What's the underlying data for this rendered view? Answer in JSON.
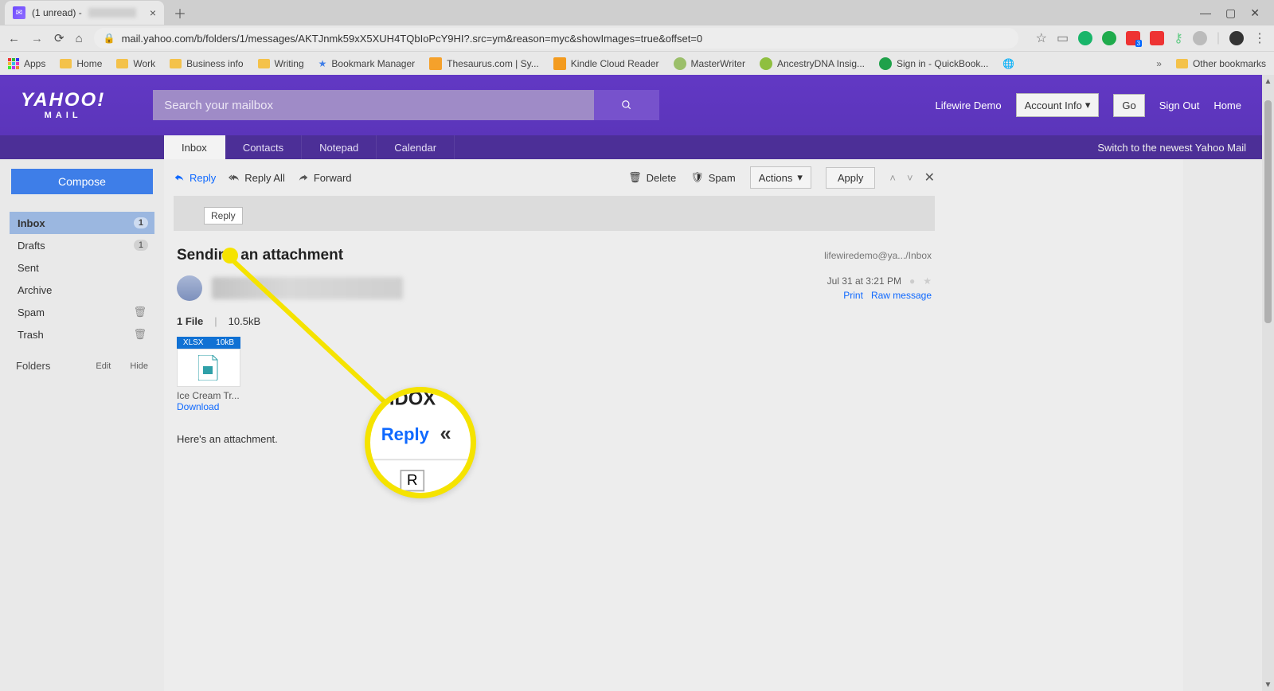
{
  "browser": {
    "tab_title": "(1 unread) -",
    "url": "mail.yahoo.com/b/folders/1/messages/AKTJnmk59xX5XUH4TQbIoPcY9HI?.src=ym&reason=myc&showImages=true&offset=0",
    "bookmarks": [
      "Apps",
      "Home",
      "Work",
      "Business info",
      "Writing",
      "Bookmark Manager",
      "Thesaurus.com | Sy...",
      "Kindle Cloud Reader",
      "MasterWriter",
      "AncestryDNA Insig...",
      "Sign in - QuickBook..."
    ],
    "other_bookmarks": "Other bookmarks"
  },
  "header": {
    "logo_top": "YAHOO!",
    "logo_sub": "MAIL",
    "search_placeholder": "Search your mailbox",
    "user_text": "Lifewire Demo",
    "account_info": "Account Info",
    "go": "Go",
    "sign_out": "Sign Out",
    "home": "Home"
  },
  "tabs": {
    "items": [
      "Inbox",
      "Contacts",
      "Notepad",
      "Calendar"
    ],
    "switch_text": "Switch to the newest Yahoo Mail"
  },
  "sidebar": {
    "compose": "Compose",
    "folders": [
      {
        "label": "Inbox",
        "count": "1",
        "active": true
      },
      {
        "label": "Drafts",
        "count": "1"
      },
      {
        "label": "Sent"
      },
      {
        "label": "Archive"
      },
      {
        "label": "Spam",
        "trash": true
      },
      {
        "label": "Trash",
        "trash": true
      }
    ],
    "folders_label": "Folders",
    "edit": "Edit",
    "hide": "Hide"
  },
  "toolbar": {
    "reply": "Reply",
    "reply_all": "Reply All",
    "forward": "Forward",
    "delete": "Delete",
    "spam": "Spam",
    "actions": "Actions",
    "apply": "Apply",
    "tooltip": "Reply"
  },
  "message": {
    "subject": "Sending an attachment",
    "path": "lifewiredemo@ya.../Inbox",
    "date": "Jul 31 at 3:21 PM",
    "print": "Print",
    "raw": "Raw message",
    "file_count_label": "1 File",
    "total_size": "10.5kB",
    "attach_ext": "XLSX",
    "attach_size": "10kB",
    "attach_name": "Ice Cream Tr...",
    "download": "Download",
    "body": "Here's an attachment."
  },
  "highlight": {
    "inbox": "IDOX",
    "reply": "Reply"
  }
}
